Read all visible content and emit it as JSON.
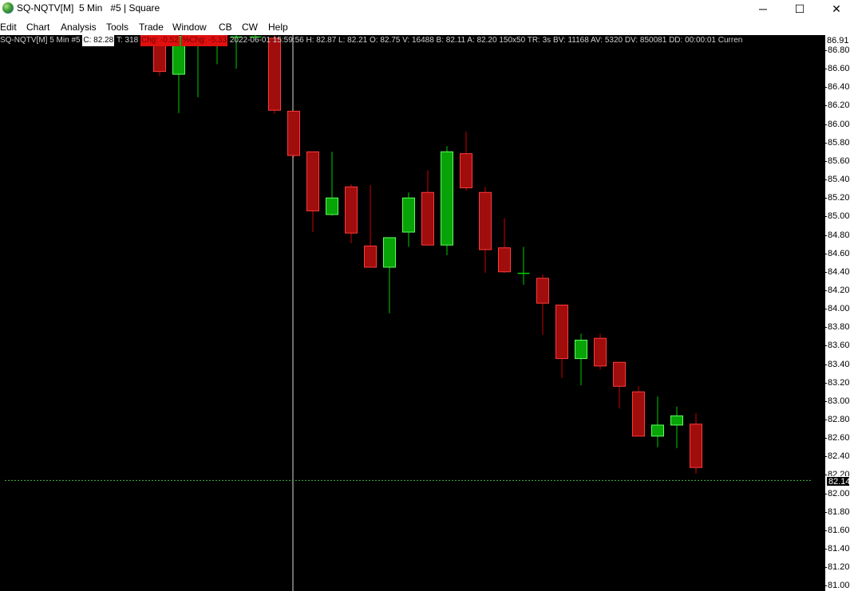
{
  "window": {
    "title": "SQ-NQTV[M]  5 Min   #5 | Square",
    "minimize_glyph": "─",
    "maximize_glyph": "☐",
    "close_glyph": "✕"
  },
  "menu": [
    "Edit",
    "Chart",
    "Analysis",
    "Tools",
    "Trade",
    "Window",
    "CB",
    "CW",
    "Help"
  ],
  "infobar": {
    "symbol": "SQ-NQTV[M]  5 Min   #5",
    "close": "C: 82.28",
    "ticks": "T: 318",
    "change": "Chg: -0.52",
    "pct_change": "%Chg: -5.33",
    "rest": "2022-06-01 15:59:56 H: 82.87 L: 82.21 O: 82.75 V: 16488 B: 82.11 A: 82.20 150x50 TR: 3s BV: 11168 AV: 5320 DV: 850081 DD: 00:00:01 Curren"
  },
  "price_tag": "82.14",
  "top_price": "86.91",
  "colors": {
    "up": "#00cc00",
    "down": "#cc0000",
    "axis_bg": "#ffffff",
    "chart_bg": "#000000",
    "last_line": "#3dbb3d"
  },
  "chart_data": {
    "type": "candlestick",
    "y_range": [
      81.0,
      86.91
    ],
    "y_ticks": [
      "86.80",
      "86.60",
      "86.40",
      "86.20",
      "86.00",
      "85.80",
      "85.60",
      "85.40",
      "85.20",
      "85.00",
      "84.80",
      "84.60",
      "84.40",
      "84.20",
      "84.00",
      "83.80",
      "83.60",
      "83.40",
      "83.20",
      "83.00",
      "82.80",
      "82.60",
      "82.40",
      "82.20",
      "82.00",
      "81.80",
      "81.60",
      "81.40",
      "81.20",
      "81.00"
    ],
    "last_price": 82.14,
    "crosshair_x_index": 7,
    "candles": [
      {
        "o": 86.98,
        "h": 87.2,
        "l": 86.52,
        "c": 86.57
      },
      {
        "o": 86.54,
        "h": 87.2,
        "l": 86.12,
        "c": 86.95
      },
      {
        "o": 86.95,
        "h": 87.1,
        "l": 86.29,
        "c": 86.95
      },
      {
        "o": 86.95,
        "h": 87.2,
        "l": 86.65,
        "c": 86.95
      },
      {
        "o": 86.95,
        "h": 87.2,
        "l": 86.6,
        "c": 86.95
      },
      {
        "o": 86.95,
        "h": 87.2,
        "l": 86.9,
        "c": 86.95
      },
      {
        "o": 86.93,
        "h": 87.2,
        "l": 86.11,
        "c": 86.15
      },
      {
        "o": 86.14,
        "h": 86.14,
        "l": 85.64,
        "c": 85.66
      },
      {
        "o": 85.7,
        "h": 85.7,
        "l": 84.83,
        "c": 85.06
      },
      {
        "o": 85.02,
        "h": 85.7,
        "l": 85.01,
        "c": 85.2
      },
      {
        "o": 85.32,
        "h": 85.35,
        "l": 84.71,
        "c": 84.82
      },
      {
        "o": 84.68,
        "h": 85.34,
        "l": 84.45,
        "c": 84.45
      },
      {
        "o": 84.45,
        "h": 84.77,
        "l": 83.95,
        "c": 84.77
      },
      {
        "o": 84.83,
        "h": 85.26,
        "l": 84.67,
        "c": 85.2
      },
      {
        "o": 85.26,
        "h": 85.5,
        "l": 84.69,
        "c": 84.69
      },
      {
        "o": 84.69,
        "h": 85.76,
        "l": 84.58,
        "c": 85.7
      },
      {
        "o": 85.68,
        "h": 85.92,
        "l": 85.28,
        "c": 85.31
      },
      {
        "o": 85.26,
        "h": 85.32,
        "l": 84.39,
        "c": 84.64
      },
      {
        "o": 84.66,
        "h": 84.98,
        "l": 84.39,
        "c": 84.4
      },
      {
        "o": 84.38,
        "h": 84.67,
        "l": 84.26,
        "c": 84.39
      },
      {
        "o": 84.33,
        "h": 84.37,
        "l": 83.72,
        "c": 84.06
      },
      {
        "o": 84.04,
        "h": 84.04,
        "l": 83.25,
        "c": 83.46
      },
      {
        "o": 83.46,
        "h": 83.73,
        "l": 83.17,
        "c": 83.66
      },
      {
        "o": 83.68,
        "h": 83.73,
        "l": 83.34,
        "c": 83.38
      },
      {
        "o": 83.42,
        "h": 83.42,
        "l": 82.92,
        "c": 83.16
      },
      {
        "o": 83.1,
        "h": 83.16,
        "l": 82.67,
        "c": 82.62
      },
      {
        "o": 82.62,
        "h": 83.05,
        "l": 82.5,
        "c": 82.74
      },
      {
        "o": 82.74,
        "h": 82.94,
        "l": 82.49,
        "c": 82.84
      },
      {
        "o": 82.75,
        "h": 82.87,
        "l": 82.21,
        "c": 82.28
      }
    ]
  }
}
